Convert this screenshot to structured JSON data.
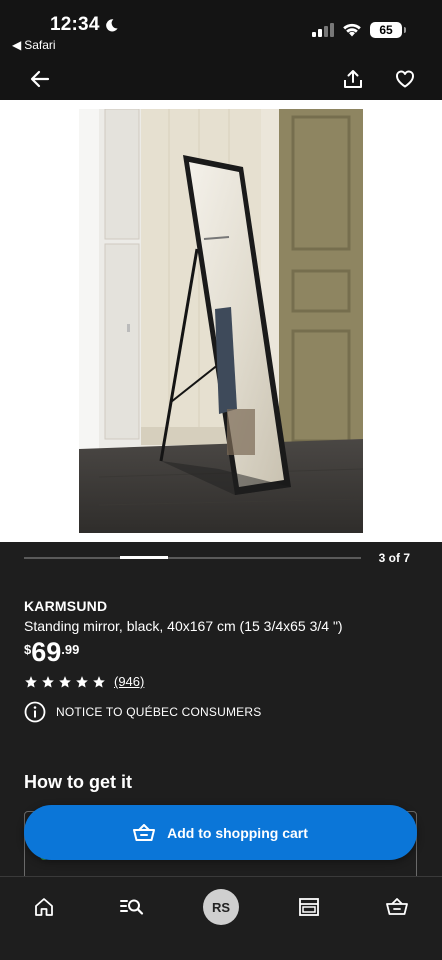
{
  "status_bar": {
    "time": "12:34",
    "back_app": "Safari",
    "battery": "65"
  },
  "icons": {
    "moon": "moon-icon",
    "signal": "signal-icon",
    "wifi": "wifi-icon",
    "back": "arrow-left-icon",
    "share": "share-icon",
    "favorite": "heart-icon",
    "info": "info-icon",
    "cart": "basket-icon",
    "home": "home-icon",
    "search": "search-icon",
    "store": "store-icon",
    "basket": "basket-icon"
  },
  "gallery": {
    "counter": "3 of 7",
    "current": 3,
    "total": 7
  },
  "product": {
    "name": "KARMSUND",
    "description": "Standing mirror, black, 40x167 cm (15 3/4x65 3/4 \")",
    "price_currency": "$",
    "price_int": "69",
    "price_dec": ".99",
    "rating_stars": 5,
    "rating_count": "(946)",
    "notice": "NOTICE TO QUÉBEC CONSUMERS"
  },
  "delivery": {
    "title": "How to get it"
  },
  "cart": {
    "button_label": "Add to shopping cart"
  },
  "tab_bar": {
    "avatar_initials": "RS"
  },
  "colors": {
    "background": "#1e1e1e",
    "accent_blue": "#0b76d8",
    "status_green": "#2f9a4e"
  }
}
